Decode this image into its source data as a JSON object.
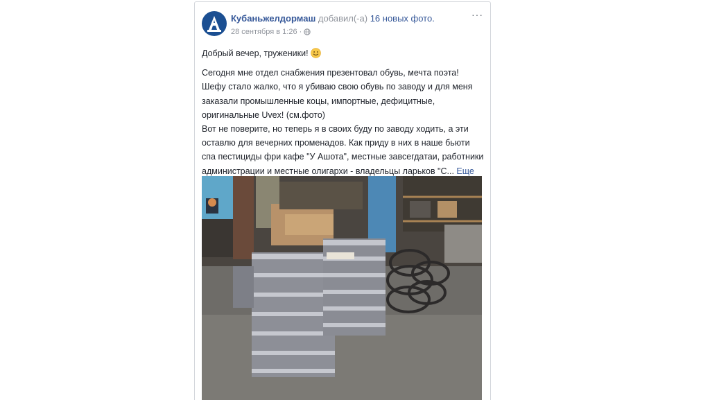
{
  "post": {
    "page_name": "Кубаньжелдормаш",
    "action_text": "добавил(-а)",
    "photo_count_text": "16 новых фото.",
    "timestamp": "28 сентября в 1:26",
    "separator": "·",
    "privacy_icon": "globe-icon",
    "options_icon": "more-options-icon",
    "options_text": "···",
    "greeting": "Добрый вечер, труженики!",
    "lines": [
      "Сегодня мне отдел снабжения презентовал обувь, мечта поэта!",
      "Шефу стало жалко, что я убиваю свою обувь по заводу и для меня",
      "заказали промышленные коцы, импортные, дефицитные,",
      "оригинальные Uvex! (см.фото)",
      "Вот не поверите, но теперь я в своих буду по заводу ходить, а эти",
      "оставлю для вечерних променадов. Как приду в них в наше бьюти",
      "спа пестициды фри кафе \"У Ашота\", местные завсегдатаи, работники",
      "администрации и местные олигархи - владельцы ларьков \"С..."
    ],
    "see_more": "Еще"
  },
  "colors": {
    "link": "#365899",
    "muted": "#90949c",
    "text": "#1d2129",
    "avatar_bg": "#1b4f92"
  }
}
